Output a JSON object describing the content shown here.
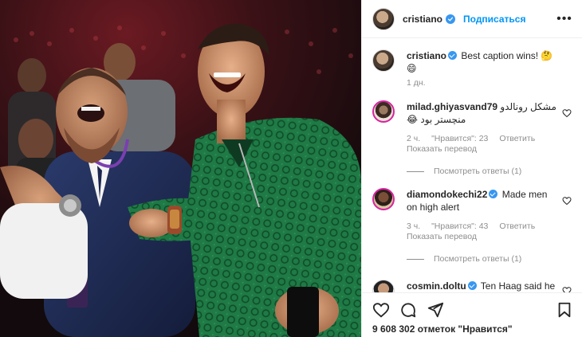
{
  "colors": {
    "accent": "#0095f6",
    "verified": "#3897f0",
    "muted": "#8e8e8e",
    "text": "#262626"
  },
  "post": {
    "photo_alt_icon": "photo"
  },
  "header": {
    "username": "cristiano",
    "follow_label": "Подписаться",
    "more_icon": "more-horizontal-icon"
  },
  "caption": {
    "username": "cristiano",
    "text": "Best caption wins! 🤔",
    "emoji_line": "😄",
    "time": "1 дн."
  },
  "comments": [
    {
      "username": "milad.ghiyasvand79",
      "text_line1": "مشکل رونالدو",
      "text_line2": "منچستر بود 😂",
      "time": "2 ч.",
      "likes": "\"Нравится\": 23",
      "reply": "Ответить",
      "translate": "Показать перевод",
      "replies": "Посмотреть ответы (1)"
    },
    {
      "username": "diamondokechi22",
      "text": "Made men on high alert",
      "time": "3 ч.",
      "likes": "\"Нравится\": 43",
      "reply": "Ответить",
      "translate": "Показать перевод",
      "replies": "Посмотреть ответы (1)"
    },
    {
      "username": "cosmin.doltu",
      "text": "Ten Haag said he"
    }
  ],
  "footer": {
    "likes_count": "9 608 302 отметок \"Нравится\""
  }
}
